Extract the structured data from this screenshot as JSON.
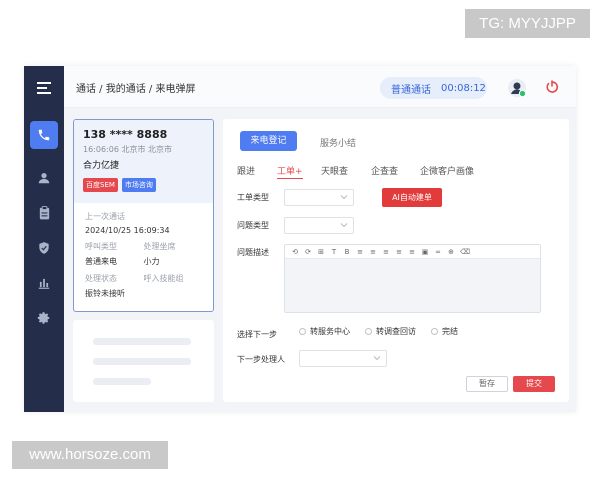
{
  "watermarks": {
    "top": "TG: MYYJJPP",
    "bottom": "www.horsoze.com"
  },
  "sidebar": {
    "items": [
      {
        "icon": "menu-icon",
        "active": false
      },
      {
        "icon": "phone-icon",
        "active": true
      },
      {
        "icon": "user-icon",
        "active": false
      },
      {
        "icon": "clipboard-icon",
        "active": false
      },
      {
        "icon": "shield-icon",
        "active": false
      },
      {
        "icon": "bar-chart-icon",
        "active": false
      },
      {
        "icon": "gear-icon",
        "active": false
      }
    ]
  },
  "header": {
    "breadcrumb": "通话 / 我的通话 / 来电弹屏",
    "call_mode": "普通通话",
    "timer": "00:08:12"
  },
  "caller": {
    "phone": "138 **** 8888",
    "time_location": "16:06:06  北京市 北京市",
    "company": "合力亿捷",
    "tags": [
      "百度SEM",
      "市场咨询"
    ],
    "last_call_label": "上一次通话",
    "last_call_time": "2024/10/25  16:09:34",
    "call_type_label": "呼叫类型",
    "call_type_value": "普通来电",
    "agent_label": "处理坐席",
    "agent_value": "小力",
    "status_label": "处理状态",
    "status_value": "振铃未接听",
    "skill_group_label": "呼入技能组"
  },
  "main": {
    "tabs": [
      "来电登记",
      "服务小结"
    ],
    "subtabs": [
      "跟进",
      "工单+",
      "天眼查",
      "企查查",
      "企微客户画像"
    ],
    "active_subtab": 1,
    "form": {
      "ticket_type_label": "工单类型",
      "issue_type_label": "问题类型",
      "ai_button": "AI自动建单",
      "description_label": "问题描述",
      "toolbar": [
        "⟲",
        "⟳",
        "⊞",
        "T",
        "B",
        "≡",
        "≡",
        "≡",
        "≡",
        "≡",
        "▣",
        "∞",
        "⊕",
        "⌫"
      ],
      "next_step_label": "选择下一步",
      "next_step_options": [
        "转服务中心",
        "转调查回访",
        "完结"
      ],
      "next_handler_label": "下一步处理人"
    },
    "save_label": "暂存",
    "submit_label": "提交"
  },
  "colors": {
    "sidebar_bg": "#242d4a",
    "accent": "#4f7cf0",
    "danger": "#e5484d"
  }
}
